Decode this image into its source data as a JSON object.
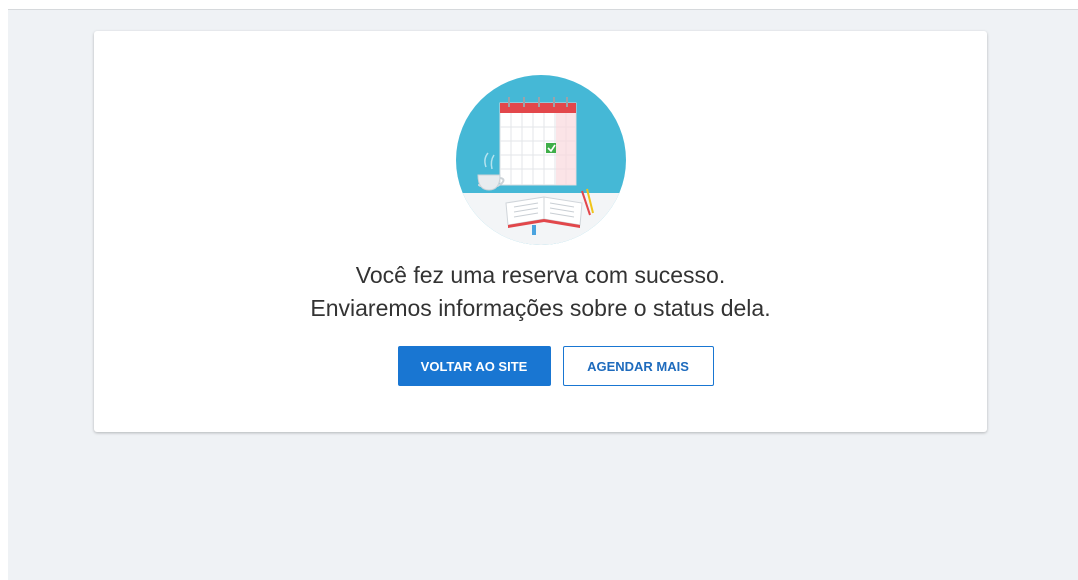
{
  "confirmation": {
    "line1": "Você fez uma reserva com sucesso.",
    "line2": "Enviaremos informações sobre o status dela."
  },
  "actions": {
    "back_to_site": "VOLTAR AO SITE",
    "schedule_more": "AGENDAR MAIS"
  },
  "illustration": {
    "icon": "calendar-check-icon",
    "colors": {
      "circle": "#45b8d6",
      "accent": "#e2474b",
      "check": "#3fae49"
    }
  },
  "colors": {
    "primary": "#1976d2",
    "page_background": "#eff2f5",
    "card_background": "#ffffff",
    "text": "#333333"
  }
}
